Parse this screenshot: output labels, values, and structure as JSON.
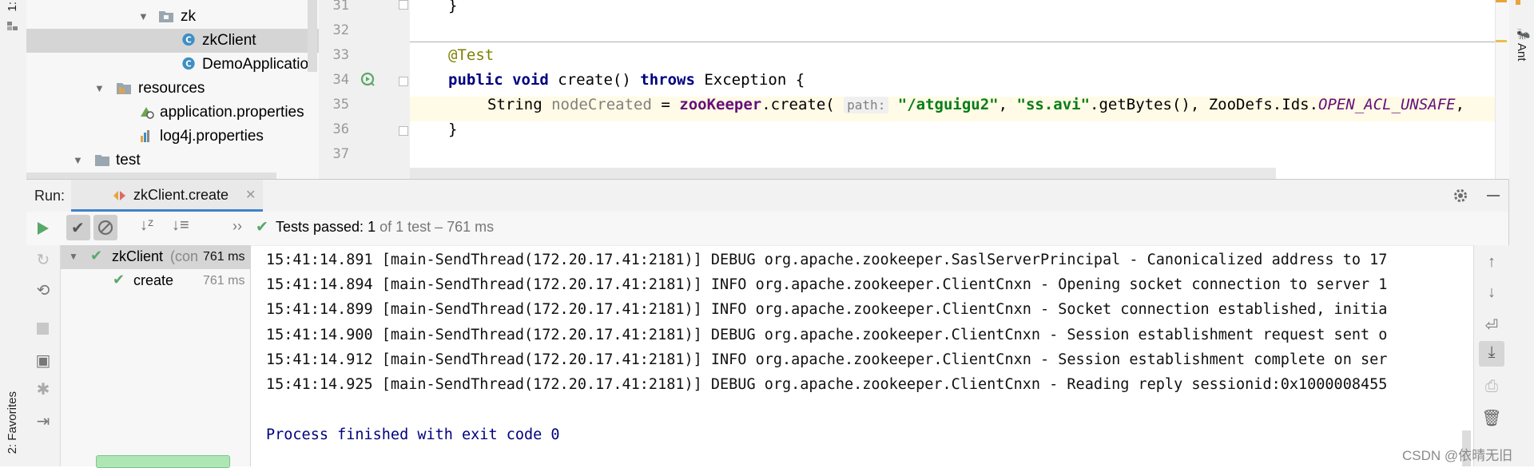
{
  "left_strip": {
    "top_tab": "1:",
    "bottom_tab": "2: Favorites"
  },
  "right_strip": {
    "ant_tab": "Ant"
  },
  "project_tree": {
    "items": [
      {
        "label": "zk",
        "type": "folder",
        "expanded": true
      },
      {
        "label": "zkClient",
        "type": "class",
        "selected": true
      },
      {
        "label": "DemoApplication",
        "type": "class"
      },
      {
        "label": "resources",
        "type": "resources-folder",
        "expanded": true
      },
      {
        "label": "application.properties",
        "type": "properties"
      },
      {
        "label": "log4j.properties",
        "type": "properties"
      },
      {
        "label": "test",
        "type": "folder",
        "expanded": true
      }
    ]
  },
  "editor": {
    "line_numbers": [
      "31",
      "32",
      "33",
      "34",
      "35",
      "36",
      "37"
    ],
    "line31": {
      "brace": "}"
    },
    "line33": {
      "annotation": "@Test"
    },
    "line34": {
      "kw_public": "public",
      "kw_void": "void",
      "method": " create() ",
      "kw_throws": "throws",
      "rest": " Exception {"
    },
    "line35": {
      "type": "String ",
      "var": "nodeCreated",
      "assign": " = ",
      "field": "zooKeeper",
      "call": ".create( ",
      "hint": "path:",
      "arg1": "\"/atguigu2\"",
      "sep1": ", ",
      "arg2": "\"ss.avi\"",
      "call2": ".getBytes(), ZooDefs.Ids.",
      "const": "OPEN_ACL_UNSAFE",
      "tail": ","
    },
    "line36": {
      "brace": "}"
    }
  },
  "run_panel": {
    "label": "Run:",
    "tab_label": "zkClient.create",
    "status_prefix": "Tests passed: ",
    "status_count": "1",
    "status_suffix": " of 1 test – 761 ms",
    "more": "››",
    "tests": [
      {
        "name": "zkClient",
        "detail": "(con",
        "time": "761 ms"
      },
      {
        "name": "create",
        "time": "761 ms"
      }
    ]
  },
  "console": {
    "lines": [
      "15:41:14.891 [main-SendThread(172.20.17.41:2181)] DEBUG org.apache.zookeeper.SaslServerPrincipal - Canonicalized address to 17",
      "15:41:14.894 [main-SendThread(172.20.17.41:2181)] INFO org.apache.zookeeper.ClientCnxn - Opening socket connection to server 1",
      "15:41:14.899 [main-SendThread(172.20.17.41:2181)] INFO org.apache.zookeeper.ClientCnxn - Socket connection established, initia",
      "15:41:14.900 [main-SendThread(172.20.17.41:2181)] DEBUG org.apache.zookeeper.ClientCnxn - Session establishment request sent o",
      "15:41:14.912 [main-SendThread(172.20.17.41:2181)] INFO org.apache.zookeeper.ClientCnxn - Session establishment complete on ser",
      "15:41:14.925 [main-SendThread(172.20.17.41:2181)] DEBUG org.apache.zookeeper.ClientCnxn - Reading reply sessionid:0x1000008455"
    ],
    "exit_message": "Process finished with exit code 0"
  },
  "watermark": "CSDN @依晴无旧",
  "colors": {
    "pass_green": "#59a869",
    "keyword": "#000080",
    "string": "#067d17",
    "annotation": "#808000",
    "field": "#660e7a"
  }
}
